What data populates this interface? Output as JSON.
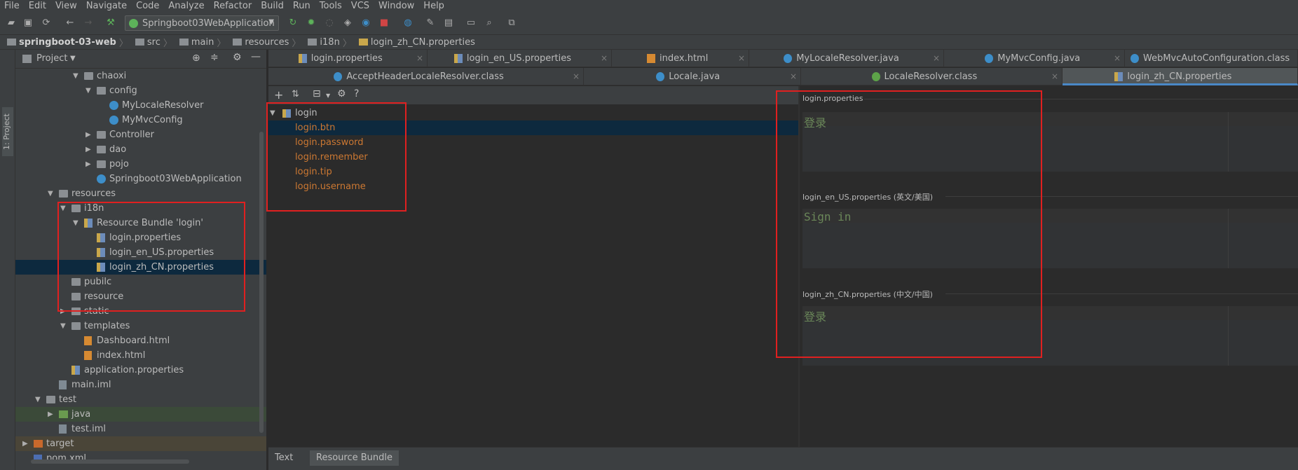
{
  "menu": [
    "File",
    "Edit",
    "View",
    "Navigate",
    "Code",
    "Analyze",
    "Refactor",
    "Build",
    "Run",
    "Tools",
    "VCS",
    "Window",
    "Help"
  ],
  "toolbar": {
    "run_config": "Springboot03WebApplication"
  },
  "breadcrumb": [
    "springboot-03-web",
    "src",
    "main",
    "resources",
    "i18n",
    "login_zh_CN.properties"
  ],
  "left_strip": {
    "label": "1: Project"
  },
  "project_panel": {
    "title": "Project",
    "tree": [
      {
        "label": "chaoxi",
        "depth": 5,
        "icon": "folder-icon",
        "expanded": true
      },
      {
        "label": "config",
        "depth": 6,
        "icon": "folder-icon",
        "expanded": true
      },
      {
        "label": "MyLocaleResolver",
        "depth": 7,
        "icon": "class-icon"
      },
      {
        "label": "MyMvcConfig",
        "depth": 7,
        "icon": "class-icon"
      },
      {
        "label": "Controller",
        "depth": 6,
        "icon": "folder-icon",
        "expanded": false
      },
      {
        "label": "dao",
        "depth": 6,
        "icon": "folder-icon",
        "expanded": false
      },
      {
        "label": "pojo",
        "depth": 6,
        "icon": "folder-icon",
        "expanded": false
      },
      {
        "label": "Springboot03WebApplication",
        "depth": 6,
        "icon": "spring-class-icon"
      },
      {
        "label": "resources",
        "depth": 3,
        "icon": "folder-icon",
        "expanded": true
      },
      {
        "label": "i18n",
        "depth": 4,
        "icon": "folder-icon",
        "expanded": true
      },
      {
        "label": "Resource Bundle 'login'",
        "depth": 5,
        "icon": "resource-bundle-icon",
        "expanded": true
      },
      {
        "label": "login.properties",
        "depth": 6,
        "icon": "properties-file-icon"
      },
      {
        "label": "login_en_US.properties",
        "depth": 6,
        "icon": "properties-file-icon"
      },
      {
        "label": "login_zh_CN.properties",
        "depth": 6,
        "icon": "properties-file-icon",
        "selected": true
      },
      {
        "label": "pubilc",
        "depth": 4,
        "icon": "folder-icon"
      },
      {
        "label": "resource",
        "depth": 4,
        "icon": "folder-icon"
      },
      {
        "label": "static",
        "depth": 4,
        "icon": "folder-icon",
        "expanded": false
      },
      {
        "label": "templates",
        "depth": 4,
        "icon": "folder-icon",
        "expanded": true
      },
      {
        "label": "Dashboard.html",
        "depth": 5,
        "icon": "html-file-icon"
      },
      {
        "label": "index.html",
        "depth": 5,
        "icon": "html-file-icon"
      },
      {
        "label": "application.properties",
        "depth": 4,
        "icon": "spring-properties-icon"
      },
      {
        "label": "main.iml",
        "depth": 3,
        "icon": "iml-file-icon"
      },
      {
        "label": "test",
        "depth": 2,
        "icon": "folder-icon",
        "expanded": true
      },
      {
        "label": "java",
        "depth": 3,
        "icon": "green-folder-icon",
        "expanded": false,
        "highlight": true
      },
      {
        "label": "test.iml",
        "depth": 3,
        "icon": "iml-file-icon"
      },
      {
        "label": "target",
        "depth": 1,
        "icon": "orange-folder-icon",
        "expanded": false,
        "highlight2": true
      },
      {
        "label": "pom.xml",
        "depth": 1,
        "icon": "maven-icon"
      }
    ]
  },
  "editor_tabs_row1": [
    {
      "label": "login.properties",
      "icon": "properties-file-icon"
    },
    {
      "label": "login_en_US.properties",
      "icon": "properties-file-icon"
    },
    {
      "label": "index.html",
      "icon": "html-file-icon"
    },
    {
      "label": "MyLocaleResolver.java",
      "icon": "class-icon"
    },
    {
      "label": "MyMvcConfig.java",
      "icon": "class-icon"
    },
    {
      "label": "WebMvcAutoConfiguration.class",
      "icon": "class-icon"
    }
  ],
  "editor_tabs_row2": [
    {
      "label": "AcceptHeaderLocaleResolver.class",
      "icon": "class-icon"
    },
    {
      "label": "Locale.java",
      "icon": "class-icon"
    },
    {
      "label": "LocaleResolver.class",
      "icon": "interface-icon"
    },
    {
      "label": "login_zh_CN.properties",
      "icon": "properties-file-icon",
      "active": true
    }
  ],
  "bundle_editor": {
    "root": "login",
    "keys": [
      "login.btn",
      "login.password",
      "login.remember",
      "login.tip",
      "login.username"
    ],
    "selected_key": "login.btn",
    "properties": [
      {
        "file": "login.properties",
        "value": "登录"
      },
      {
        "file": "login_en_US.properties (英文/美国)",
        "value": "Sign in"
      },
      {
        "file": "login_zh_CN.properties (中文/中国)",
        "value": "登录"
      }
    ]
  },
  "bottom_tabs": [
    {
      "label": "Text",
      "active": false
    },
    {
      "label": "Resource Bundle",
      "active": true
    }
  ],
  "colors": {
    "key_text": "#cc7832",
    "value_text": "#6a8759",
    "annotation": "#e02020",
    "selection": "#0d293e"
  }
}
